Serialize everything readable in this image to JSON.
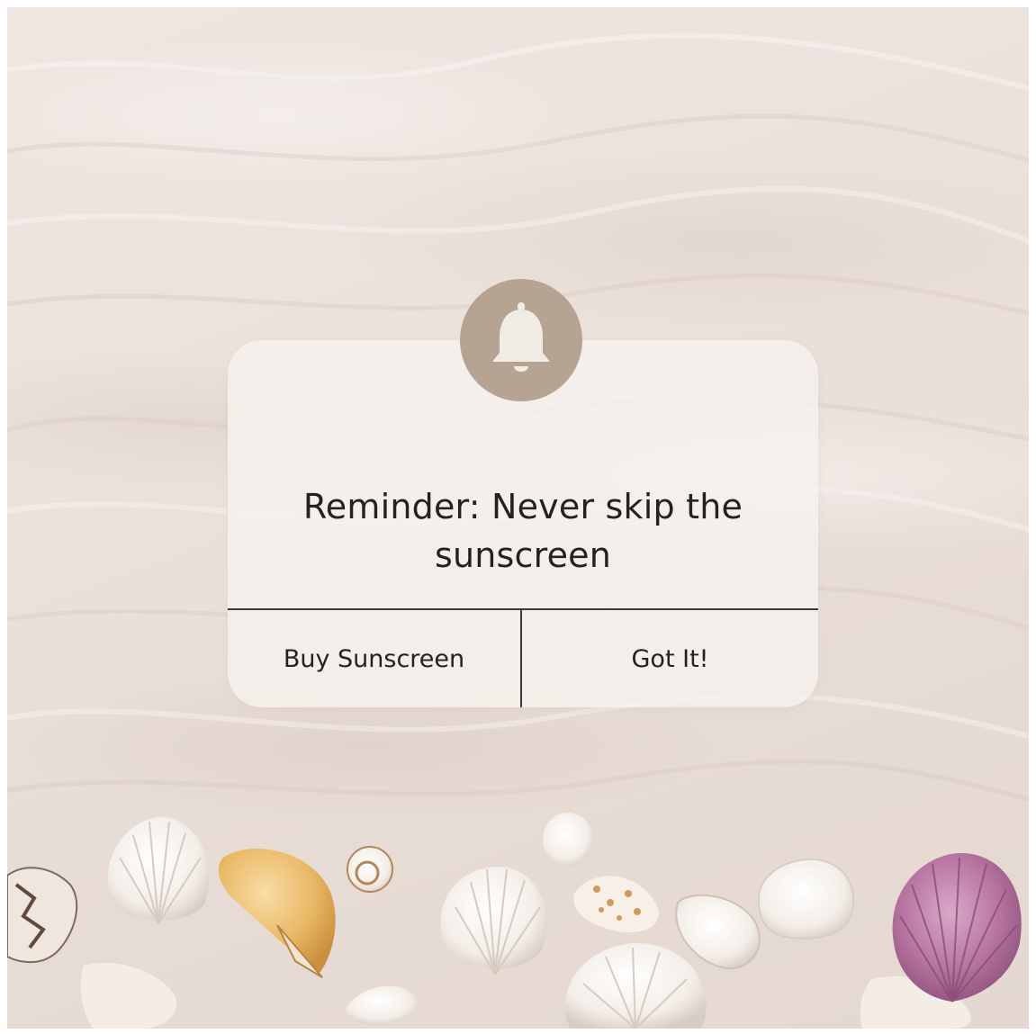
{
  "notification": {
    "message": "Reminder: Never skip the sunscreen",
    "icon": "bell-icon",
    "buttons": {
      "primary_label": "Buy Sunscreen",
      "secondary_label": "Got It!"
    }
  },
  "colors": {
    "sand": "#ece2dc",
    "card": "#f6f1ee",
    "badge": "#b7a392",
    "text": "#222222"
  }
}
